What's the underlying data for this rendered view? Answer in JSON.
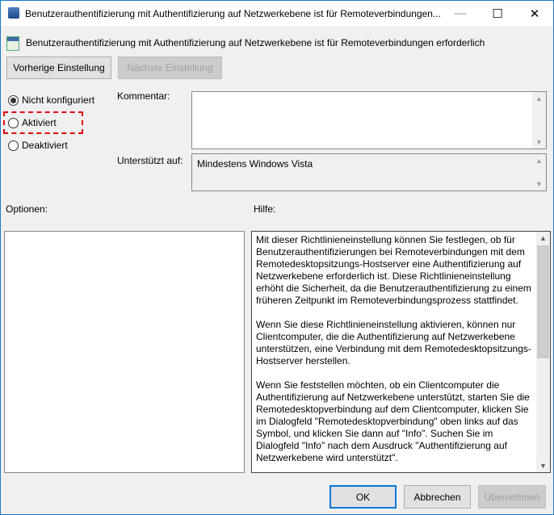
{
  "window": {
    "title": "Benutzerauthentifizierung mit Authentifizierung auf Netzwerkebene ist für Remoteverbindungen...",
    "minimize": "—",
    "maximize": "☐",
    "close": "✕"
  },
  "header": {
    "policy_title": "Benutzerauthentifizierung mit Authentifizierung auf Netzwerkebene ist für Remoteverbindungen erforderlich"
  },
  "nav": {
    "prev": "Vorherige Einstellung",
    "next": "Nächste Einstellung"
  },
  "state": {
    "options": [
      "Nicht konfiguriert",
      "Aktiviert",
      "Deaktiviert"
    ],
    "selected": "Nicht konfiguriert",
    "highlighted": "Aktiviert",
    "highlight_color": "#e8000b"
  },
  "comment": {
    "label": "Kommentar:",
    "value": ""
  },
  "supported": {
    "label": "Unterstützt auf:",
    "value": "Mindestens Windows Vista"
  },
  "options_label": "Optionen:",
  "help_label": "Hilfe:",
  "help": {
    "paragraphs": [
      "Mit dieser Richtlinieneinstellung können Sie festlegen, ob für Benutzerauthentifizierungen bei Remoteverbindungen mit dem Remotedesktopsitzungs-Hostserver eine Authentifizierung auf Netzwerkebene erforderlich ist. Diese Richtlinieneinstellung erhöht die Sicherheit, da die Benutzerauthentifizierung zu einem früheren Zeitpunkt im Remoteverbindungsprozess stattfindet.",
      "Wenn Sie diese Richtlinieneinstellung aktivieren, können nur Clientcomputer, die die Authentifizierung auf Netzwerkebene unterstützen, eine Verbindung mit dem Remotedesktopsitzungs-Hostserver herstellen.",
      "Wenn Sie feststellen möchten, ob ein Clientcomputer die Authentifizierung auf Netzwerkebene unterstützt, starten Sie die Remotedesktopverbindung auf dem Clientcomputer, klicken Sie im Dialogfeld \"Remotedesktopverbindung\" oben links auf das Symbol, und klicken Sie dann auf \"Info\". Suchen Sie im Dialogfeld \"Info\" nach dem Ausdruck \"Authentifizierung auf Netzwerkebene wird unterstützt\"."
    ]
  },
  "footer": {
    "ok": "OK",
    "cancel": "Abbrechen",
    "apply": "Übernehmen"
  }
}
